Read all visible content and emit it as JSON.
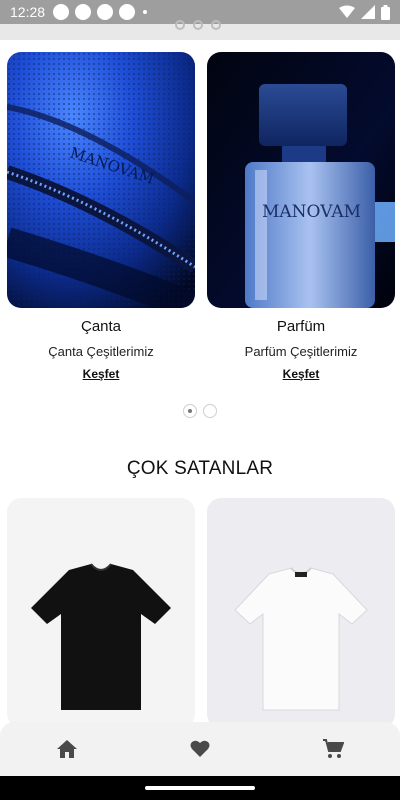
{
  "status": {
    "time": "12:28"
  },
  "categories": [
    {
      "title": "Çanta",
      "subtitle": "Çanta Çeşitlerimiz",
      "link": "Keşfet",
      "brand_text": "MANOVAM"
    },
    {
      "title": "Parfüm",
      "subtitle": "Parfüm Çeşitlerimiz",
      "link": "Keşfet",
      "brand_text": "MANOVAM"
    }
  ],
  "carousel": {
    "pages": 2,
    "active_index": 0
  },
  "bestsellers": {
    "title": "ÇOK SATANLAR"
  },
  "products": [
    {
      "image": "black-tshirt",
      "color": "#111111"
    },
    {
      "image": "white-tshirt",
      "color": "#fafafa"
    }
  ],
  "bottom_nav": {
    "items": [
      {
        "icon": "home-icon"
      },
      {
        "icon": "heart-icon"
      },
      {
        "icon": "cart-icon"
      }
    ]
  },
  "colors": {
    "status_bar": "#9e9e9e",
    "accent_blue": "#1f4fd8",
    "nav_bg": "#f2f2f2"
  }
}
